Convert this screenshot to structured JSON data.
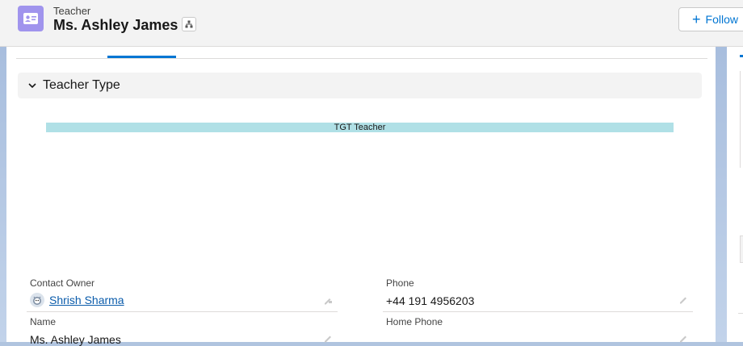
{
  "header": {
    "object_label": "Teacher",
    "record_title": "Ms. Ashley James",
    "follow_label": "Follow"
  },
  "section": {
    "title": "Teacher Type",
    "bar_text": "TGT Teacher"
  },
  "fields": {
    "contact_owner": {
      "label": "Contact Owner",
      "value": "Shrish Sharma"
    },
    "phone": {
      "label": "Phone",
      "value": "+44 191 4956203"
    },
    "name": {
      "label": "Name",
      "value": "Ms. Ashley James"
    },
    "home_phone": {
      "label": "Home Phone",
      "value": ""
    }
  },
  "colors": {
    "brand_blue": "#0176d3",
    "object_icon": "#a094ed",
    "bar_fill": "#b0e0e6"
  },
  "icons": [
    "contact-card-icon",
    "hierarchy-icon",
    "plus-icon",
    "chevron-down-icon",
    "avatar-icon",
    "edit-pencil-icon",
    "lock-edit-icon"
  ]
}
